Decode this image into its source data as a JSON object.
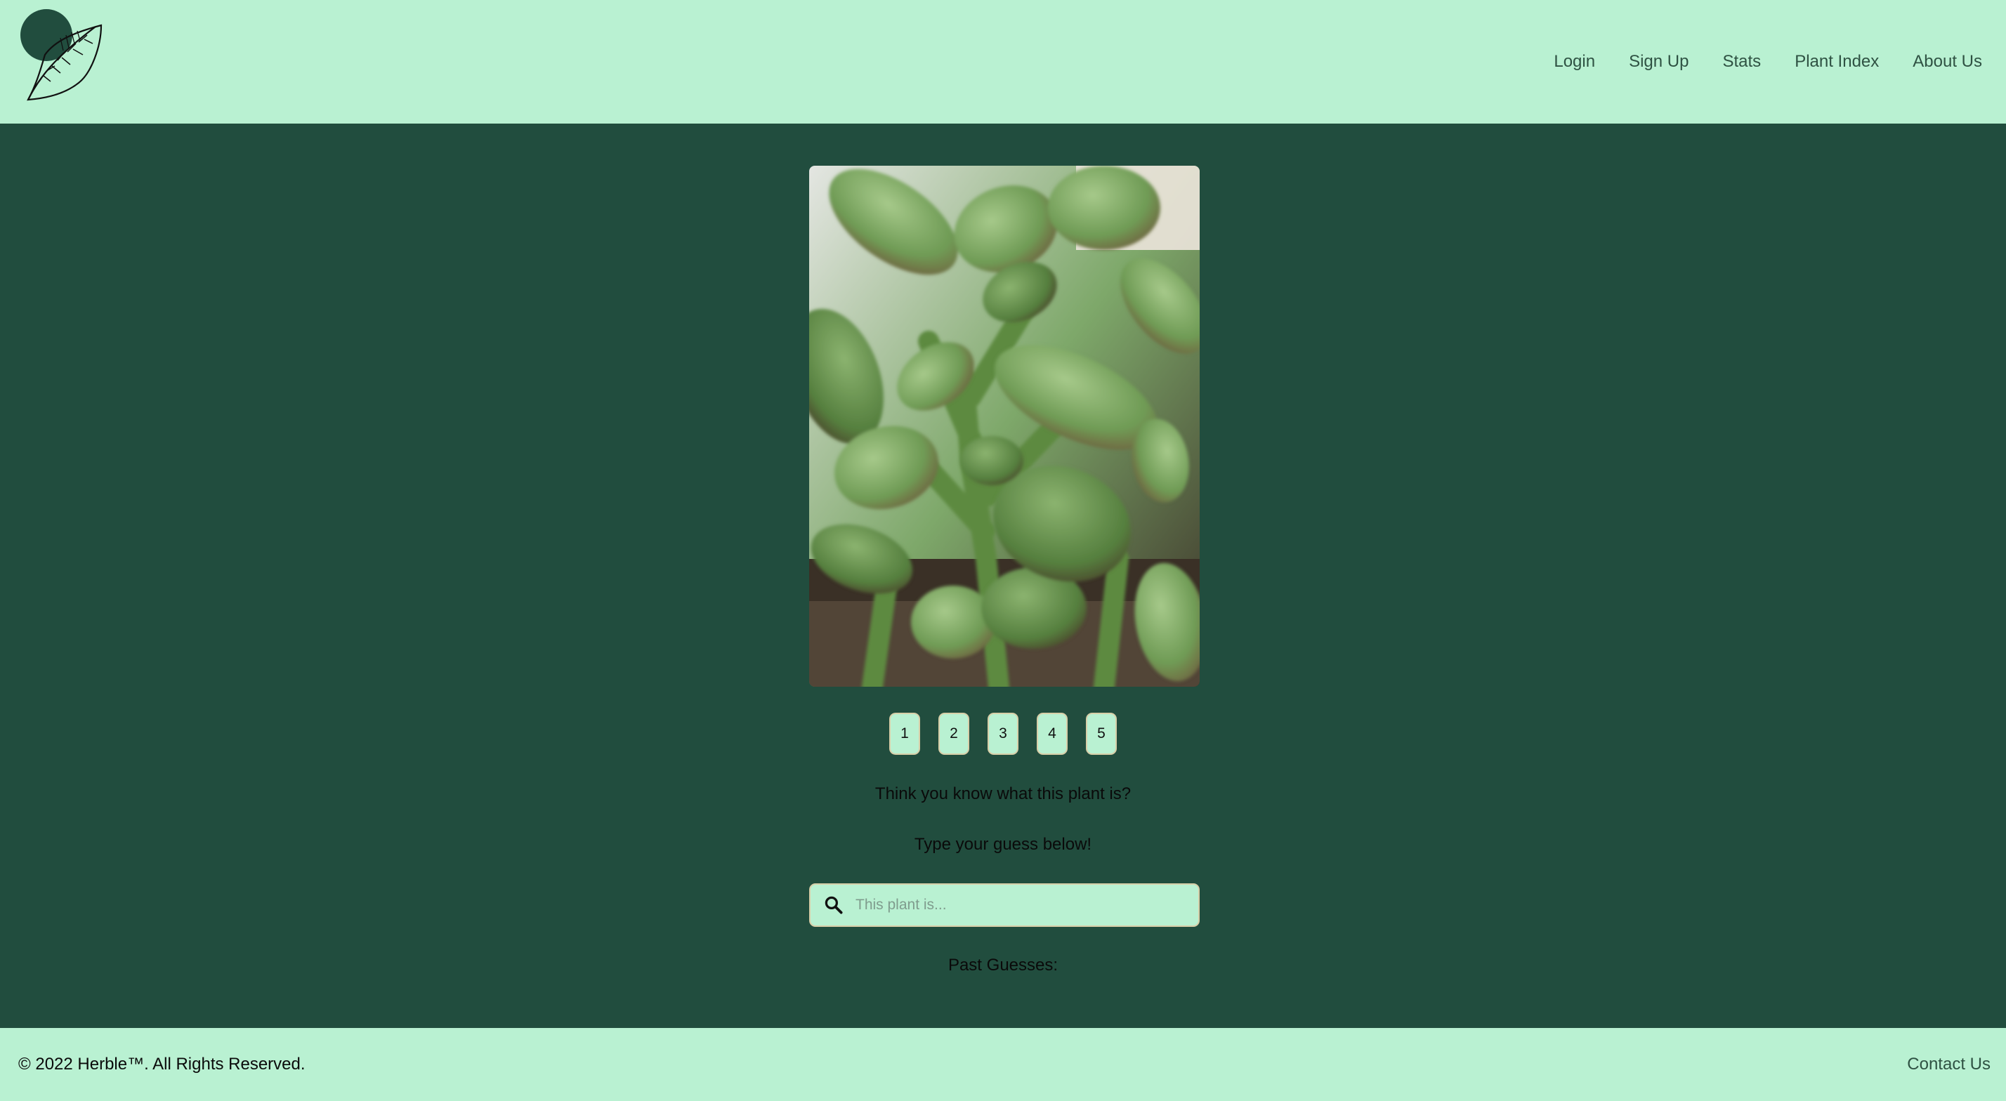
{
  "header": {
    "logo_icon": "leaf-logo-icon",
    "nav": [
      {
        "label": "Login"
      },
      {
        "label": "Sign Up"
      },
      {
        "label": "Stats"
      },
      {
        "label": "Plant Index"
      },
      {
        "label": "About Us"
      }
    ]
  },
  "game": {
    "photo_subject": "jade plant close-up",
    "hints": [
      "1",
      "2",
      "3",
      "4",
      "5"
    ],
    "prompt_line1": "Think you know what this plant is?",
    "prompt_line2": "Type your guess below!",
    "search": {
      "icon": "search-icon",
      "placeholder": "This plant is...",
      "value": ""
    },
    "past_guesses_label": "Past Guesses:"
  },
  "footer": {
    "copyright": "© 2022 Herble™. All Rights Reserved.",
    "contact": "Contact Us"
  },
  "colors": {
    "header_bg": "#b9f1d2",
    "body_bg": "#214d3e",
    "nav_text": "#2f5243",
    "button_border": "#d8cfa9"
  }
}
